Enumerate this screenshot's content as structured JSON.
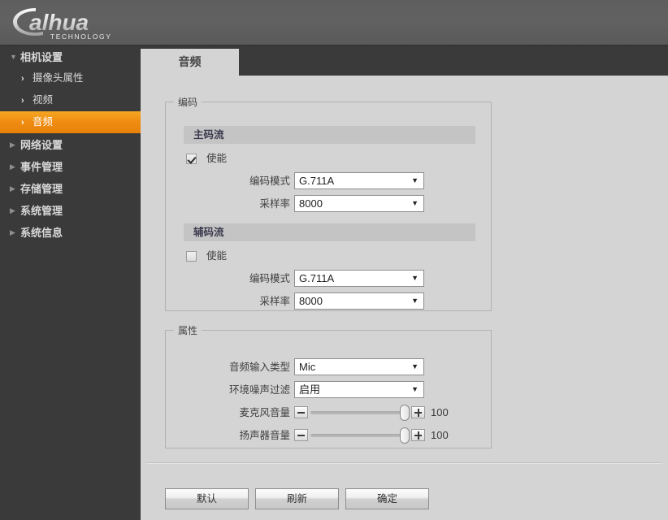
{
  "brand": {
    "name": "alhua",
    "tagline": "TECHNOLOGY"
  },
  "sidebar": {
    "groups": [
      {
        "label": "相机设置",
        "icon": "triangle-down-icon",
        "expanded": true,
        "children": [
          {
            "label": "摄像头属性",
            "icon": "chevron-right-icon",
            "active": false
          },
          {
            "label": "视频",
            "icon": "chevron-right-icon",
            "active": false
          },
          {
            "label": "音频",
            "icon": "chevron-right-icon",
            "active": true
          }
        ]
      },
      {
        "label": "网络设置",
        "icon": "triangle-right-icon",
        "expanded": false,
        "children": []
      },
      {
        "label": "事件管理",
        "icon": "triangle-right-icon",
        "expanded": false,
        "children": []
      },
      {
        "label": "存储管理",
        "icon": "triangle-right-icon",
        "expanded": false,
        "children": []
      },
      {
        "label": "系统管理",
        "icon": "triangle-right-icon",
        "expanded": false,
        "children": []
      },
      {
        "label": "系统信息",
        "icon": "triangle-right-icon",
        "expanded": false,
        "children": []
      }
    ]
  },
  "tabs": [
    {
      "label": "音频",
      "active": true
    }
  ],
  "encode_section": {
    "legend": "编码",
    "main_stream": {
      "header": "主码流",
      "enable_label": "使能",
      "enable_checked": true,
      "encode_mode_label": "编码模式",
      "encode_mode_value": "G.711A",
      "sample_rate_label": "采样率",
      "sample_rate_value": "8000"
    },
    "aux_stream": {
      "header": "辅码流",
      "enable_label": "使能",
      "enable_checked": false,
      "encode_mode_label": "编码模式",
      "encode_mode_value": "G.711A",
      "sample_rate_label": "采样率",
      "sample_rate_value": "8000"
    }
  },
  "attribute_section": {
    "legend": "属性",
    "audio_input_type_label": "音频输入类型",
    "audio_input_type_value": "Mic",
    "noise_filter_label": "环境噪声过滤",
    "noise_filter_value": "启用",
    "mic_volume_label": "麦克风音量",
    "mic_volume_value": "100",
    "speaker_volume_label": "扬声器音量",
    "speaker_volume_value": "100",
    "slider_min": 0,
    "slider_max": 100,
    "decrement_icon": "minus-icon",
    "increment_icon": "plus-icon"
  },
  "footer": {
    "default_label": "默认",
    "refresh_label": "刷新",
    "confirm_label": "确定"
  },
  "colors": {
    "accent": "#ef8b10",
    "sidebar_bg": "#3a3a3a",
    "banner_bg": "#5e5e5e",
    "content_bg": "#d4d4d4",
    "subheader_bg": "#c4c4c4"
  }
}
